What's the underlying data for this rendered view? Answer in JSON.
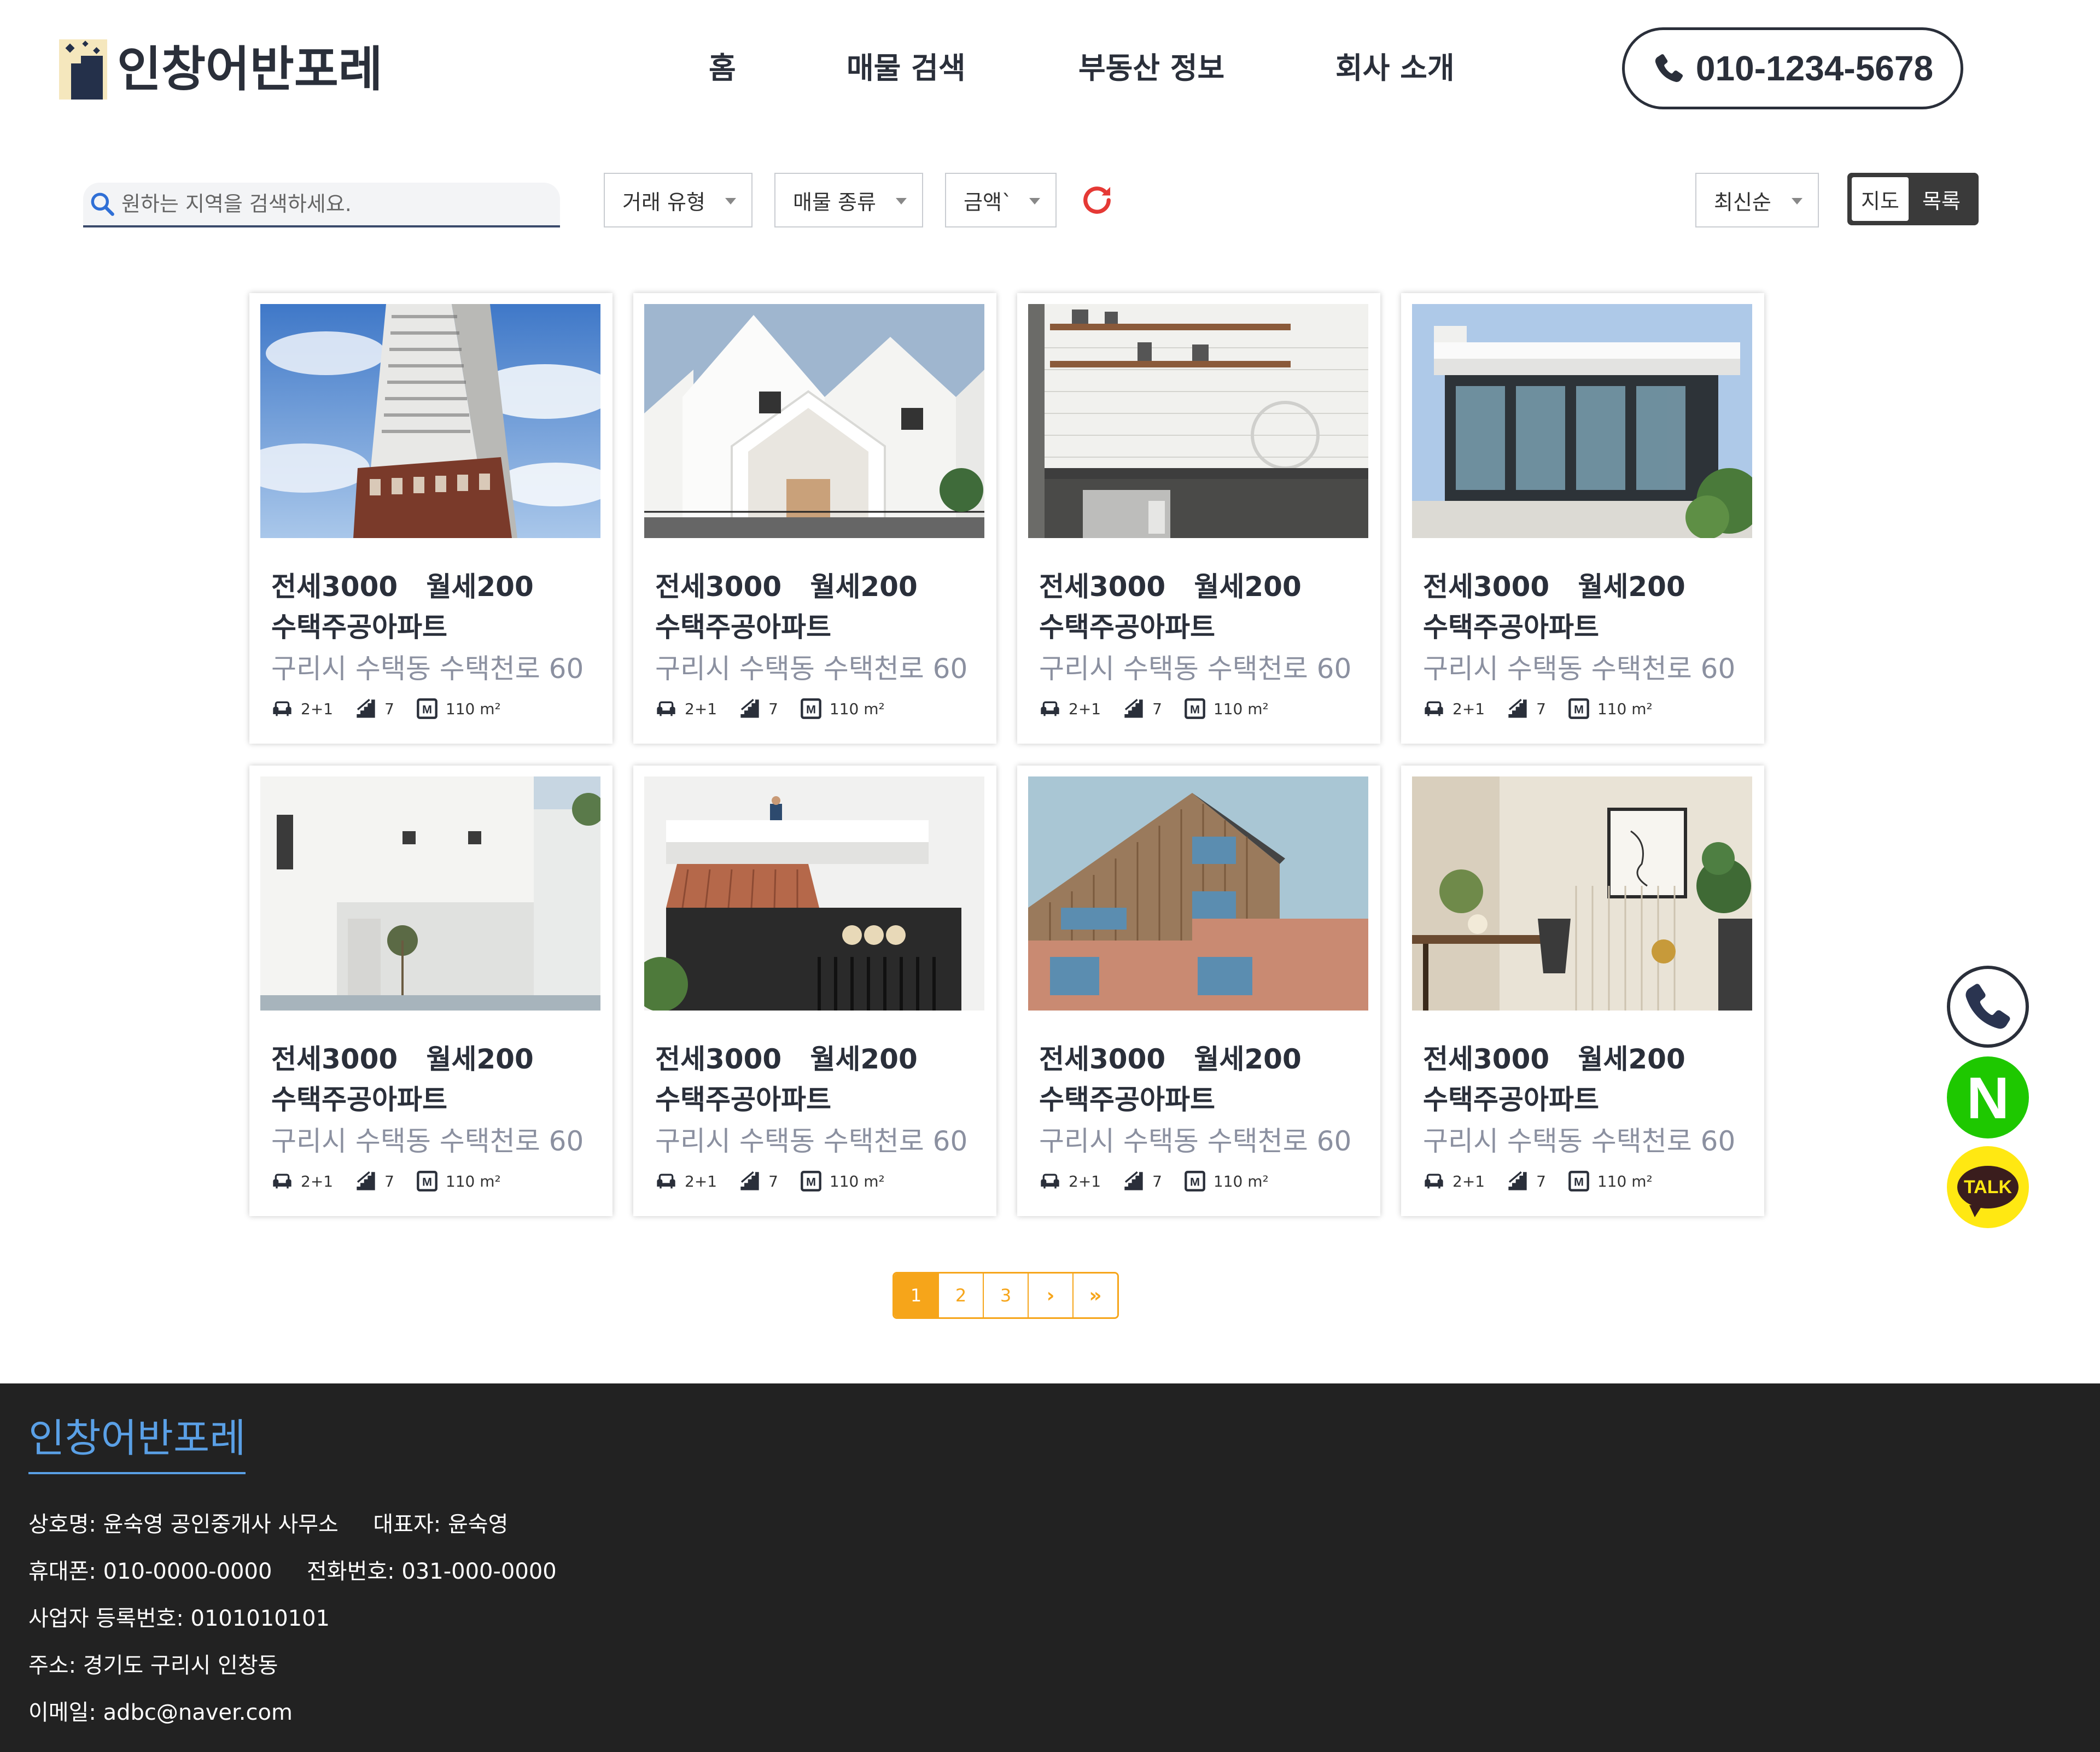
{
  "header": {
    "logo_text": "인창어반포레",
    "nav": [
      "홈",
      "매물 검색",
      "부동산 정보",
      "회사 소개"
    ],
    "phone": "010-1234-5678"
  },
  "filters": {
    "search_placeholder": "원하는 지역을 검색하세요.",
    "deal_type": "거래 유형",
    "property_type": "매물 종류",
    "price": "금액`",
    "sort": "최신순",
    "view_map": "지도",
    "view_list": "목록"
  },
  "listings": [
    {
      "price": "전세3000   월세200",
      "name": "수택주공아파트",
      "address": "구리시 수택동 수택천로 60",
      "rooms": "2+1",
      "floor": "7",
      "area": "110 m²",
      "photo": "highrise-apartment"
    },
    {
      "price": "전세3000   월세200",
      "name": "수택주공아파트",
      "address": "구리시 수택동 수택천로 60",
      "rooms": "2+1",
      "floor": "7",
      "area": "110 m²",
      "photo": "white-gabled-house"
    },
    {
      "price": "전세3000   월세200",
      "name": "수택주공아파트",
      "address": "구리시 수택동 수택천로 60",
      "rooms": "2+1",
      "floor": "7",
      "area": "110 m²",
      "photo": "kitchen"
    },
    {
      "price": "전세3000   월세200",
      "name": "수택주공아파트",
      "address": "구리시 수택동 수택천로 60",
      "rooms": "2+1",
      "floor": "7",
      "area": "110 m²",
      "photo": "modern-glass-house"
    },
    {
      "price": "전세3000   월세200",
      "name": "수택주공아파트",
      "address": "구리시 수택동 수택천로 60",
      "rooms": "2+1",
      "floor": "7",
      "area": "110 m²",
      "photo": "white-minimal-house"
    },
    {
      "price": "전세3000   월세200",
      "name": "수택주공아파트",
      "address": "구리시 수택동 수택천로 60",
      "rooms": "2+1",
      "floor": "7",
      "area": "110 m²",
      "photo": "tiled-roof-house"
    },
    {
      "price": "전세3000   월세200",
      "name": "수택주공아파트",
      "address": "구리시 수택동 수택천로 60",
      "rooms": "2+1",
      "floor": "7",
      "area": "110 m²",
      "photo": "wood-brick-building"
    },
    {
      "price": "전세3000   월세200",
      "name": "수택주공아파트",
      "address": "구리시 수택동 수택천로 60",
      "rooms": "2+1",
      "floor": "7",
      "area": "110 m²",
      "photo": "interior-desk"
    }
  ],
  "pagination": {
    "pages": [
      "1",
      "2",
      "3"
    ],
    "next": "›",
    "last": "»",
    "current": "1"
  },
  "floating": {
    "naver": "N",
    "kakao": "TALK"
  },
  "footer": {
    "title": "인창어반포레",
    "line1": "상호명: 윤숙영 공인중개사 사무소     대표자: 윤숙영",
    "line2": "휴대폰: 010-0000-0000     전화번호: 031-000-0000",
    "line3": "사업자 등록번호: 0101010101",
    "line4": "주소: 경기도 구리시 인창동",
    "line5": "이메일: adbc@naver.com"
  },
  "colors": {
    "accent": "#f6a51a",
    "footer_bg": "#222222",
    "footer_title": "#5aa0e6",
    "naver": "#1ec800",
    "kakao": "#ffe812",
    "text": "#2a2f3a"
  }
}
